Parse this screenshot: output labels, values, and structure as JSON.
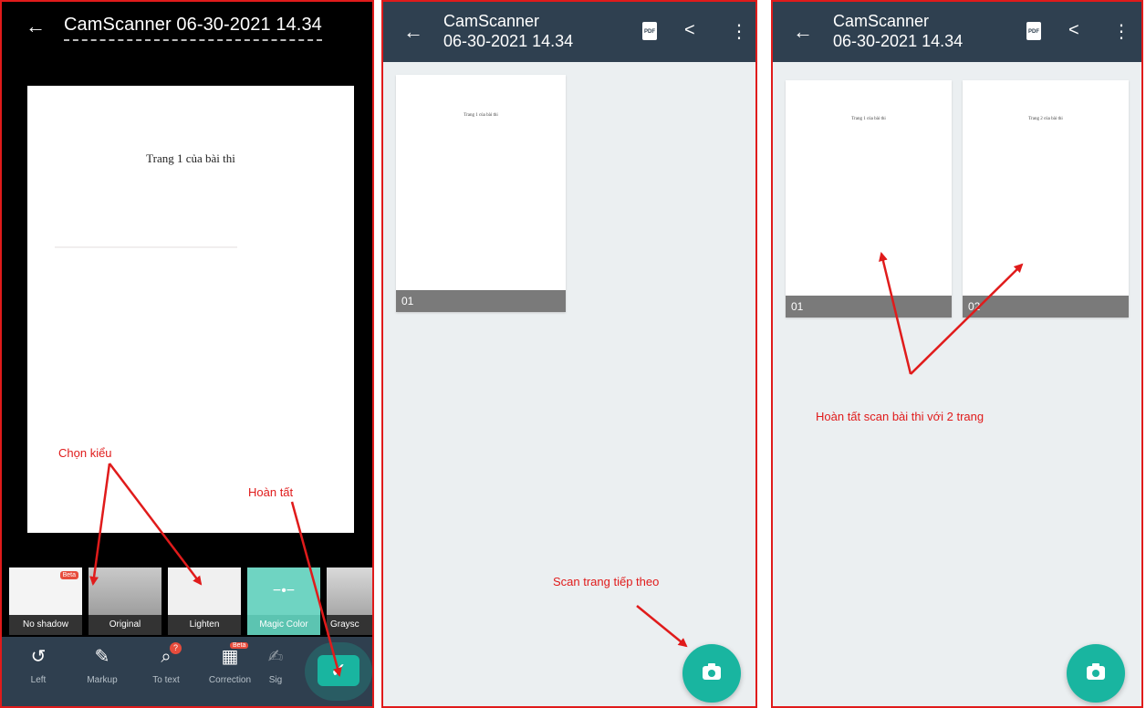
{
  "panel1": {
    "title": "CamScanner 06-30-2021 14.34",
    "page_text": "Trang 1 của bài thi",
    "filters": [
      {
        "label": "No shadow",
        "beta": "Beta"
      },
      {
        "label": "Original"
      },
      {
        "label": "Lighten"
      },
      {
        "label": "Magic Color"
      },
      {
        "label": "Graysc"
      }
    ],
    "tools": [
      {
        "label": "Left",
        "icon": "rotate-left-icon"
      },
      {
        "label": "Markup",
        "icon": "pen-icon"
      },
      {
        "label": "To text",
        "icon": "ocr-icon",
        "badge": "?"
      },
      {
        "label": "Correction",
        "icon": "grid-icon",
        "beta": "Beta"
      },
      {
        "label": "Sig",
        "icon": "signature-icon"
      }
    ],
    "annot_style": "Chọn kiểu",
    "annot_done": "Hoàn tất"
  },
  "panel2": {
    "title_line1": "CamScanner",
    "title_line2": "06-30-2021 14.34",
    "pages": [
      {
        "number": "01",
        "text": "Trang 1 của bài thi"
      }
    ],
    "annot": "Scan trang tiếp theo"
  },
  "panel3": {
    "title_line1": "CamScanner",
    "title_line2": "06-30-2021 14.34",
    "pages": [
      {
        "number": "01",
        "text": "Trang 1 của bài thi"
      },
      {
        "number": "02",
        "text": "Trang 2 của bài thi"
      }
    ],
    "annot": "Hoàn tất scan bài thi với 2 trang"
  },
  "colors": {
    "accent": "#19b5a0",
    "appbar": "#2f4050",
    "annotation": "#e01b1b",
    "background": "#ebeff1"
  }
}
